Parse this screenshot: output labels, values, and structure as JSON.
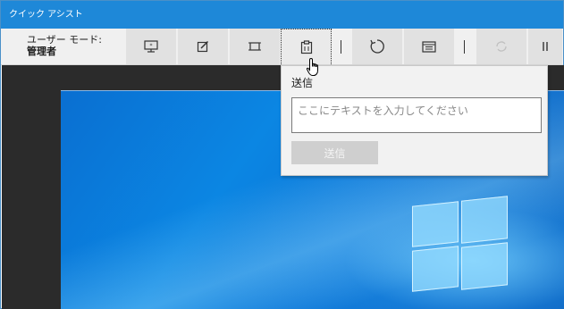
{
  "window": {
    "title": "クイック アシスト"
  },
  "toolbar": {
    "user_mode_label": "ユーザー モード:",
    "user_mode_value": "管理者",
    "buttons": [
      {
        "icon": "select-monitor-icon",
        "enabled": true
      },
      {
        "icon": "annotate-icon",
        "enabled": true
      },
      {
        "icon": "actual-size-icon",
        "enabled": true
      },
      {
        "icon": "clipboard-send-icon",
        "enabled": true,
        "active": true
      },
      {
        "icon": "restart-icon",
        "enabled": true
      },
      {
        "icon": "task-manager-icon",
        "enabled": true
      },
      {
        "icon": "reconnect-icon",
        "enabled": false
      },
      {
        "icon": "pause-icon",
        "enabled": true
      }
    ]
  },
  "send_popup": {
    "title": "送信",
    "input_placeholder": "ここにテキストを入力してください",
    "send_label": "送信"
  },
  "colors": {
    "titlebar": "#1e88d8",
    "toolbar": "#f0f0f0",
    "desktop_blue": "#0a74d6"
  }
}
